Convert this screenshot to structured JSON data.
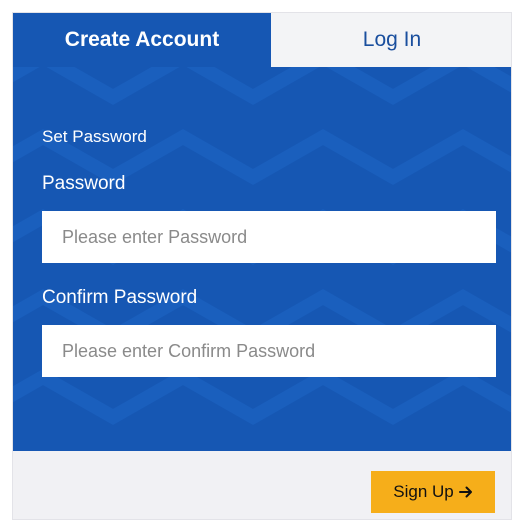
{
  "tabs": {
    "create_account": "Create Account",
    "log_in": "Log In"
  },
  "form": {
    "section_title": "Set Password",
    "password_label": "Password",
    "password_placeholder": "Please enter Password",
    "password_value": "",
    "confirm_label": "Confirm Password",
    "confirm_placeholder": "Please enter Confirm Password",
    "confirm_value": ""
  },
  "footer": {
    "signup_label": "Sign Up",
    "signup_icon": "arrow-right-icon"
  },
  "colors": {
    "primary_blue": "#1657b3",
    "accent_yellow": "#f6ae1a",
    "footer_bg": "#f1f1f4"
  }
}
